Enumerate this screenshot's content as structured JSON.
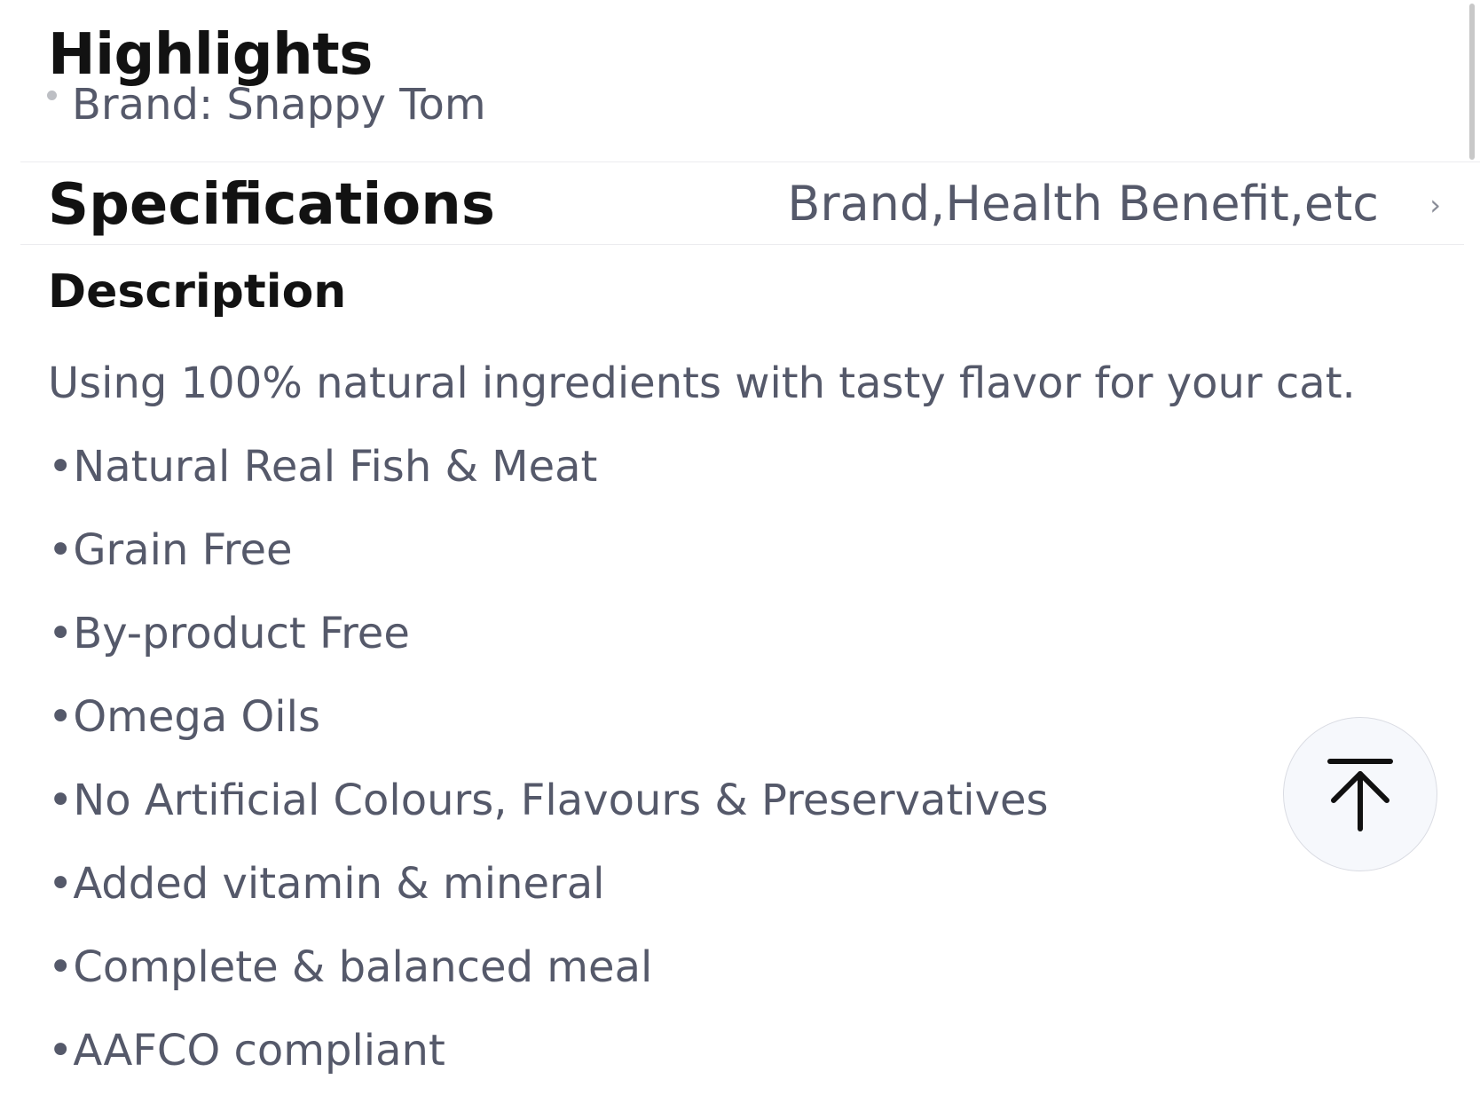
{
  "highlights": {
    "title": "Highlights",
    "items": [
      "Brand: Snappy Tom"
    ]
  },
  "specifications": {
    "title": "Specifications",
    "summary": "Brand,Health Benefit,etc",
    "chevron": "›"
  },
  "description": {
    "title": "Description",
    "intro": "Using 100% natural ingredients with tasty flavor for your cat.",
    "items": [
      "•Natural Real Fish & Meat",
      "•Grain Free",
      "•By-product Free",
      "•Omega Oils",
      "•No Artificial Colours, Flavours & Preservatives",
      "•Added vitamin & mineral",
      "•Complete & balanced meal",
      "•AAFCO compliant"
    ]
  },
  "icons": {
    "back_to_top": "arrow-up-to-line-icon"
  },
  "colors": {
    "heading": "#121212",
    "body_text": "#55596a",
    "divider": "#ececef",
    "back_to_top_bg": "#f6f8fc"
  }
}
